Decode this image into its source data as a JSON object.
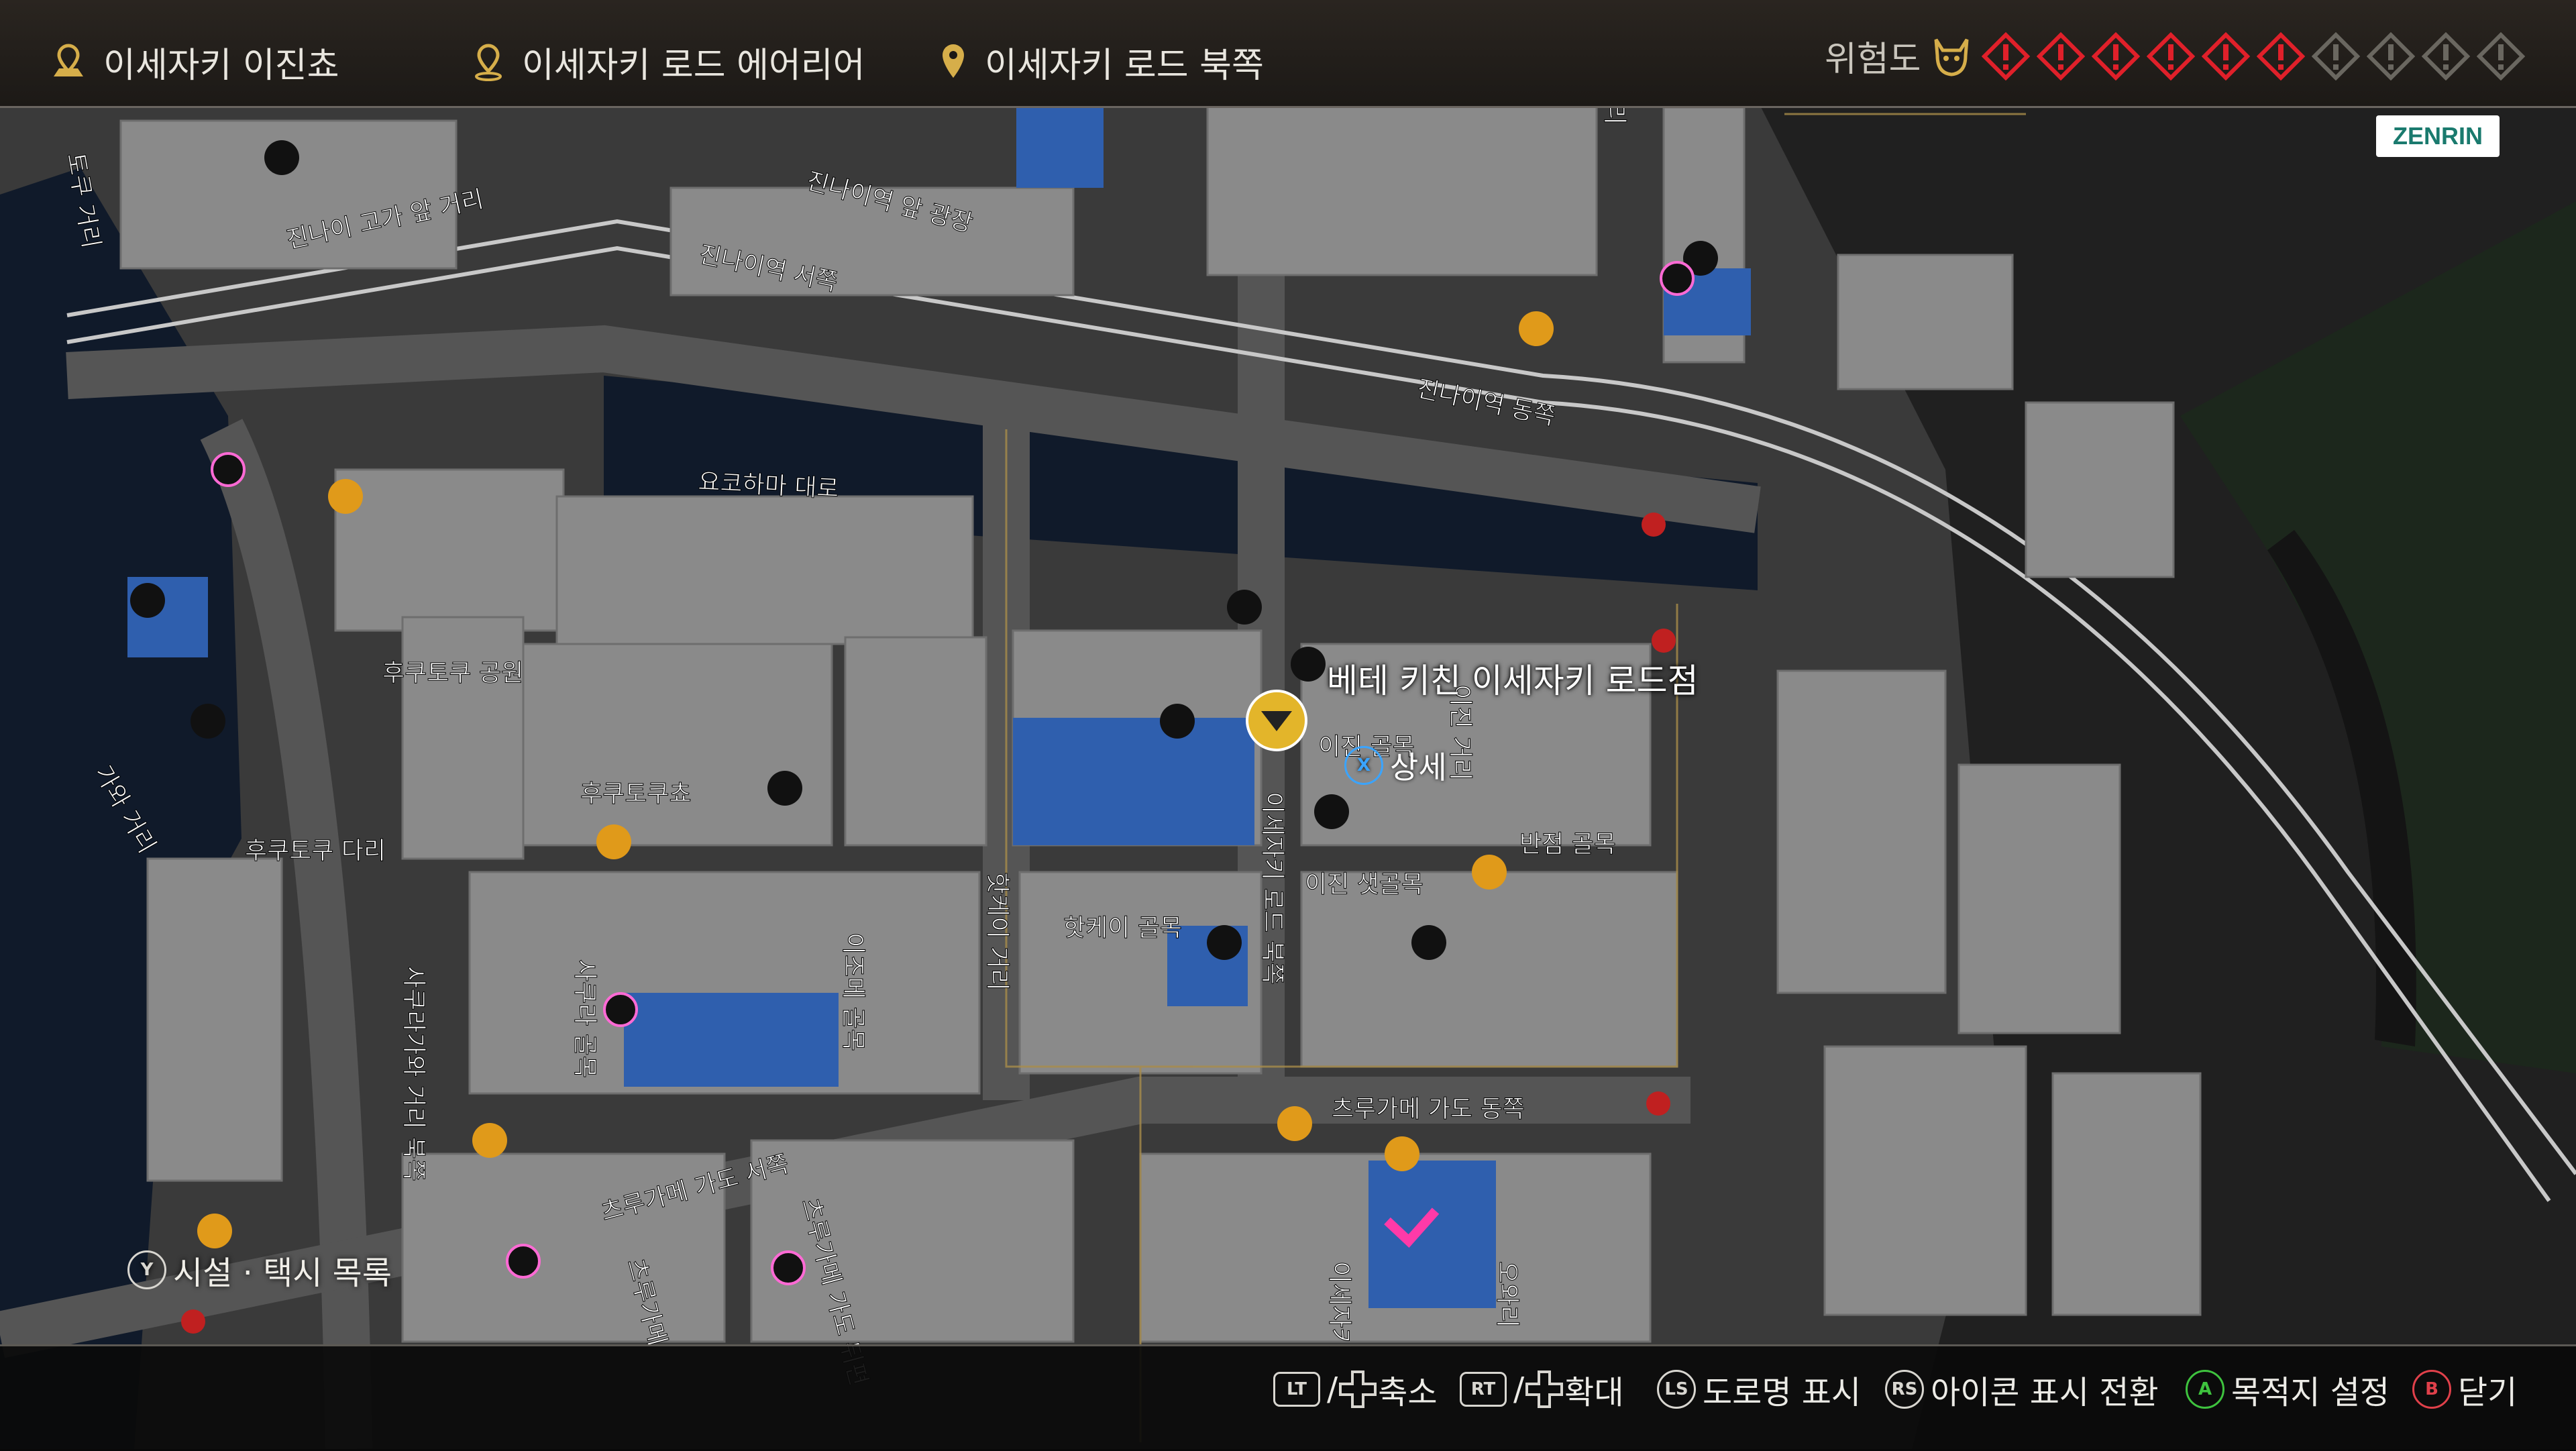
{
  "breadcrumbs": [
    "이세자키 이진쵸",
    "이세자키 로드 에어리어",
    "이세자키 로드 북쪽"
  ],
  "danger": {
    "label": "위험도",
    "level": 6,
    "max": 10
  },
  "watermark": "ZENRIN",
  "popup": {
    "title": "베테 키친 이세자키 로드점",
    "detail_button": "X",
    "detail_label": "상세"
  },
  "facility_list": {
    "button": "Y",
    "label": "시설 · 택시 목록"
  },
  "controls": [
    {
      "button": "LT",
      "separator": "/",
      "label": "축소"
    },
    {
      "button": "RT",
      "separator": "/",
      "label": "확대"
    },
    {
      "button": "LS",
      "label": "도로명 표시"
    },
    {
      "button": "RS",
      "label": "아이콘 표시 전환"
    },
    {
      "button": "A",
      "label": "목적지 설정"
    },
    {
      "button": "B",
      "label": "닫기"
    }
  ],
  "street_labels": [
    "진나이 고가 앞 거리",
    "진나이역 앞 광장",
    "진나이역 서쪽",
    "진나이역 동쪽",
    "요코하마 대로",
    "후쿠토쿠 공원",
    "후쿠토쿠쵸",
    "후쿠토쿠 다리",
    "핫케이 거리",
    "핫케이 골목",
    "이세자키 로드 북쪽",
    "이진 골목",
    "이진 샛골목",
    "반점 골목",
    "이진 거리",
    "이조메 골목",
    "사쿠라 골목",
    "사쿠라가와 거리 북쪽",
    "츠루가메 가도 서쪽",
    "츠루가메 가도 동쪽",
    "츠루가메 가도 뒤편",
    "이세자키",
    "오와리",
    "츠루가메",
    "가와 거리",
    "토쿠 거리",
    "거리"
  ],
  "colors": {
    "danger_on": "#e0202a",
    "highlight_block": "#2f5fae",
    "road": "#4a4a4a",
    "block": "#8d8d8d",
    "park": "#1e2a1e",
    "water": "#0b1424"
  }
}
